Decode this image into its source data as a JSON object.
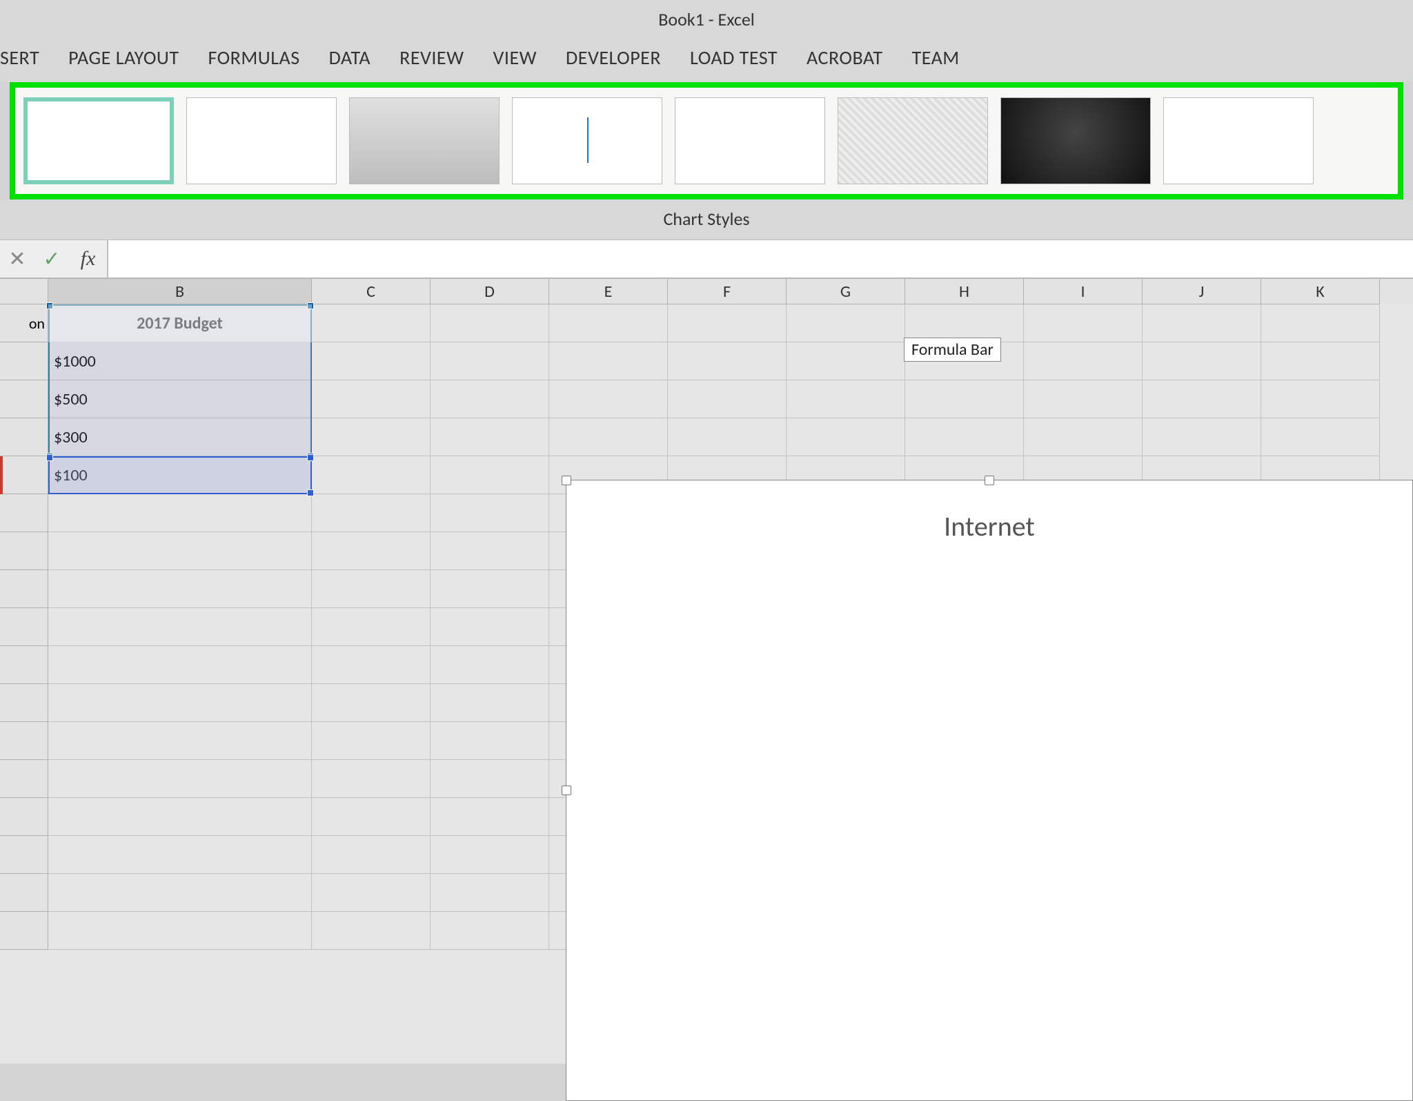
{
  "title": "Book1 - Excel",
  "tabs": [
    "SERT",
    "PAGE LAYOUT",
    "FORMULAS",
    "DATA",
    "REVIEW",
    "VIEW",
    "DEVELOPER",
    "LOAD TEST",
    "ACROBAT",
    "TEAM"
  ],
  "chart_styles_group": "Chart Styles",
  "formula_bar": {
    "cancel_glyph": "✕",
    "enter_glyph": "✓",
    "fx_label": "fx",
    "value": ""
  },
  "tooltip": "Formula Bar",
  "columns": [
    "B",
    "C",
    "D",
    "E",
    "F",
    "G",
    "H",
    "I",
    "J",
    "K"
  ],
  "row1_partial_A": "on",
  "cells": {
    "B1": "2017 Budget",
    "B2": "$1000",
    "B3": "$500",
    "B4": "$300",
    "B5": "$100"
  },
  "chart": {
    "title": "Internet"
  },
  "chart_data": {
    "type": "pie",
    "title": "Internet",
    "categories": [],
    "values": [
      1000,
      500,
      300,
      100
    ],
    "series_label": "2017 Budget",
    "note": "chart body not yet visible in crop"
  }
}
